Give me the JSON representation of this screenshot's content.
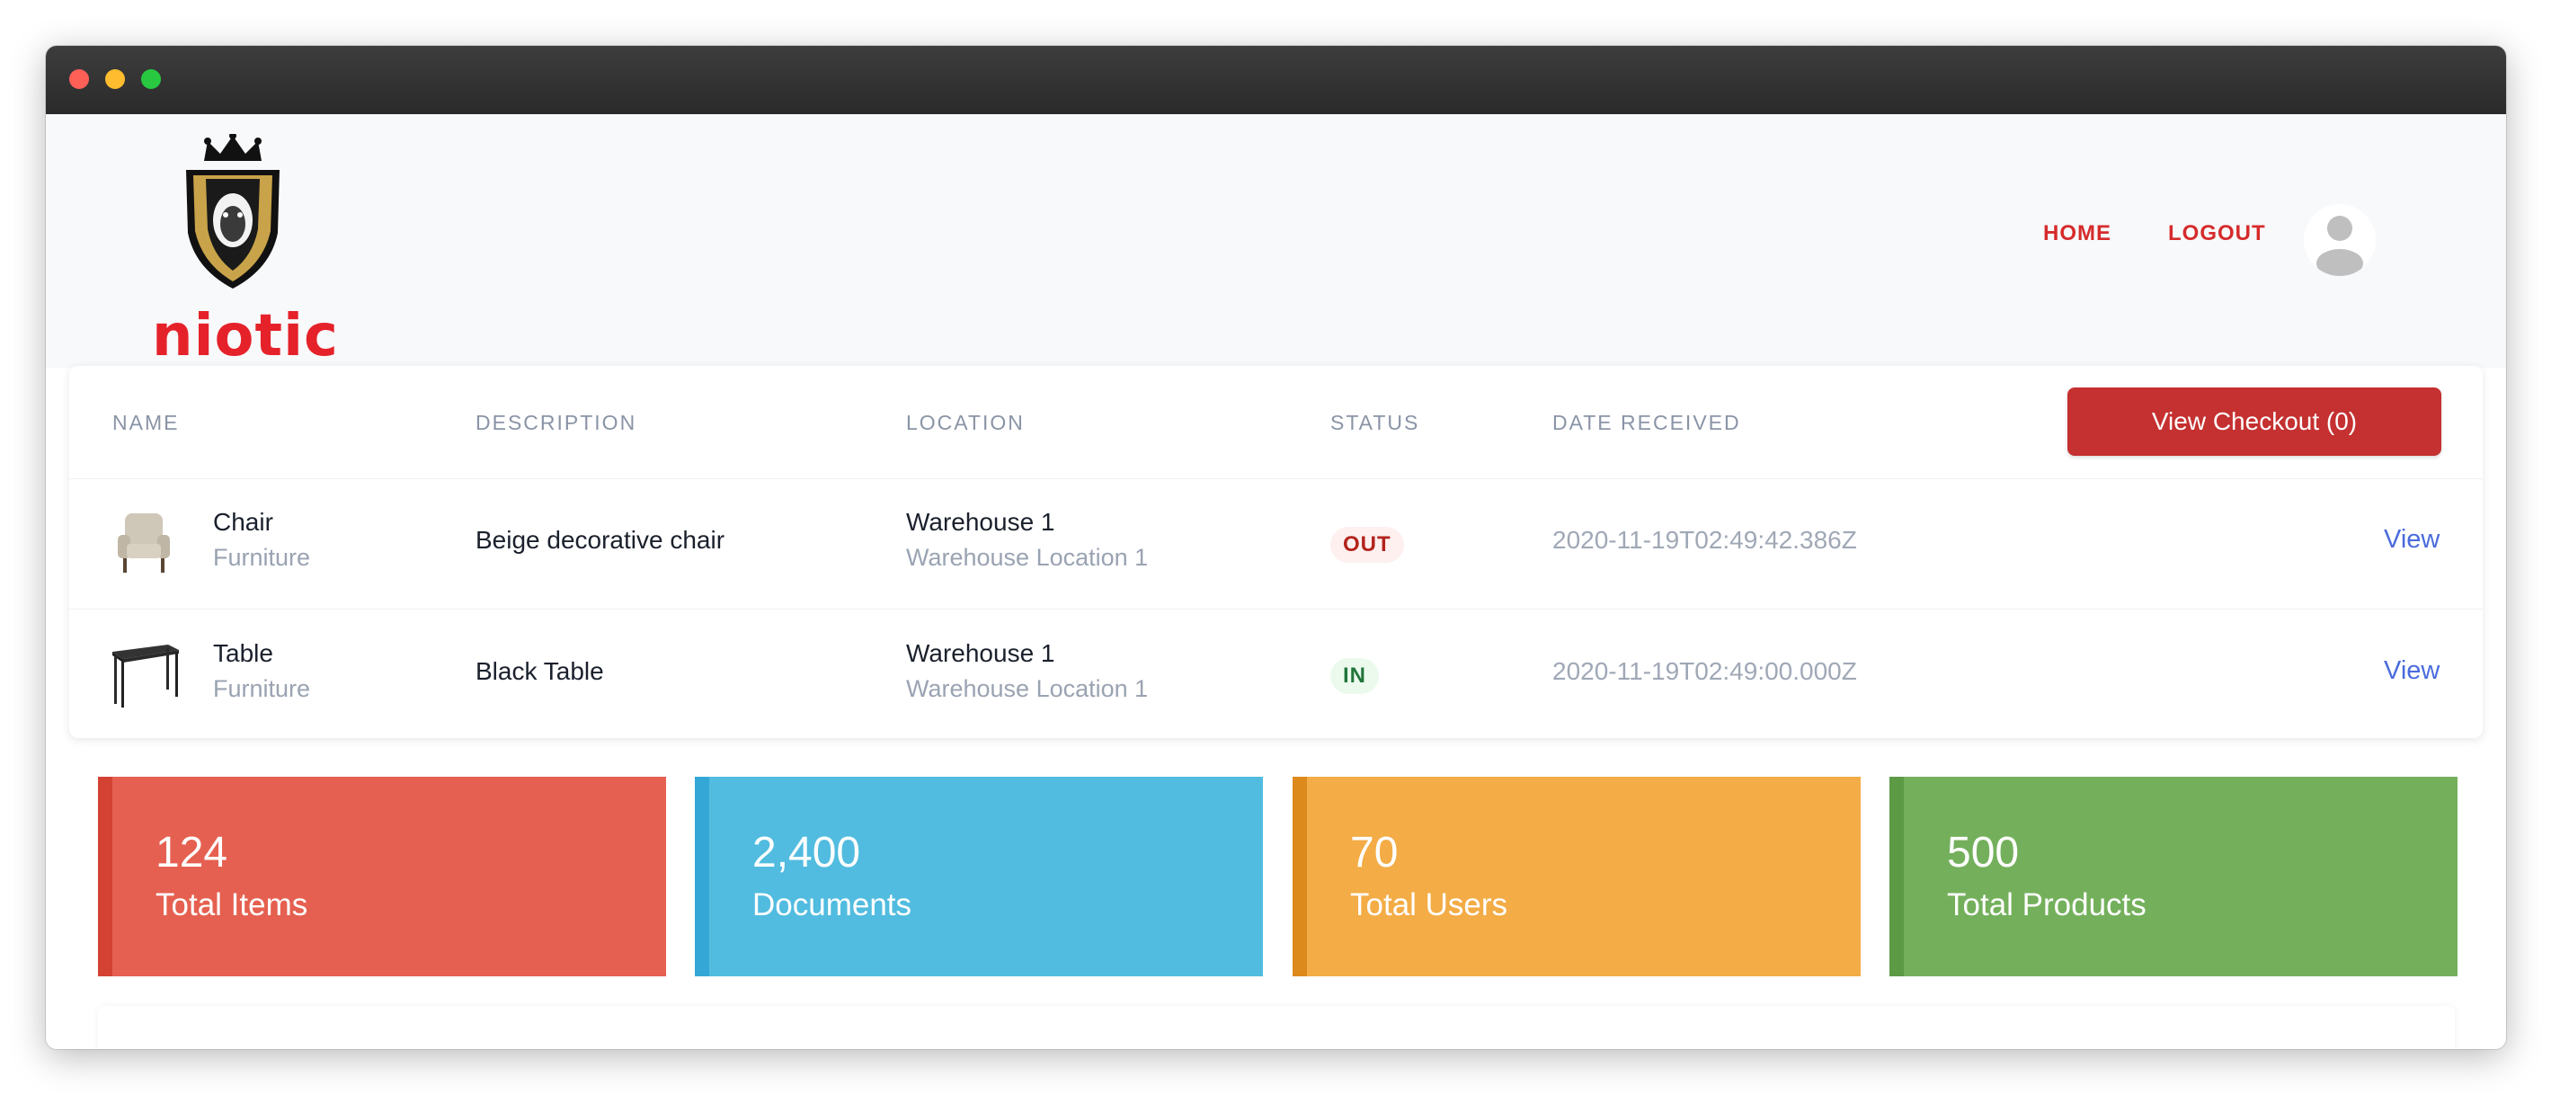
{
  "nav": {
    "home": "HOME",
    "logout": "LOGOUT"
  },
  "logo": {
    "text": "niotic"
  },
  "table": {
    "headers": [
      "NAME",
      "DESCRIPTION",
      "LOCATION",
      "STATUS",
      "DATE RECEIVED"
    ],
    "checkout_label": "View Checkout (0)",
    "rows": [
      {
        "name": "Chair",
        "category": "Furniture",
        "description": "Beige decorative chair",
        "location": "Warehouse 1",
        "sublocation": "Warehouse Location 1",
        "status": "OUT",
        "date": "2020-11-19T02:49:42.386Z",
        "action": "View"
      },
      {
        "name": "Table",
        "category": "Furniture",
        "description": "Black Table",
        "location": "Warehouse 1",
        "sublocation": "Warehouse Location 1",
        "status": "IN",
        "date": "2020-11-19T02:49:00.000Z",
        "action": "View"
      }
    ]
  },
  "stats": [
    {
      "value": "124",
      "label": "Total Items",
      "color": "#e56050",
      "accent": "#d34232"
    },
    {
      "value": "2,400",
      "label": "Documents",
      "color": "#51bcdf",
      "accent": "#35a7d6"
    },
    {
      "value": "70",
      "label": "Total Users",
      "color": "#f3ac46",
      "accent": "#dc8a1c"
    },
    {
      "value": "500",
      "label": "Total Products",
      "color": "#74b05c",
      "accent": "#5c9a45"
    }
  ],
  "colors": {
    "brand_red": "#c53030",
    "link_blue": "#4a6bdc"
  }
}
